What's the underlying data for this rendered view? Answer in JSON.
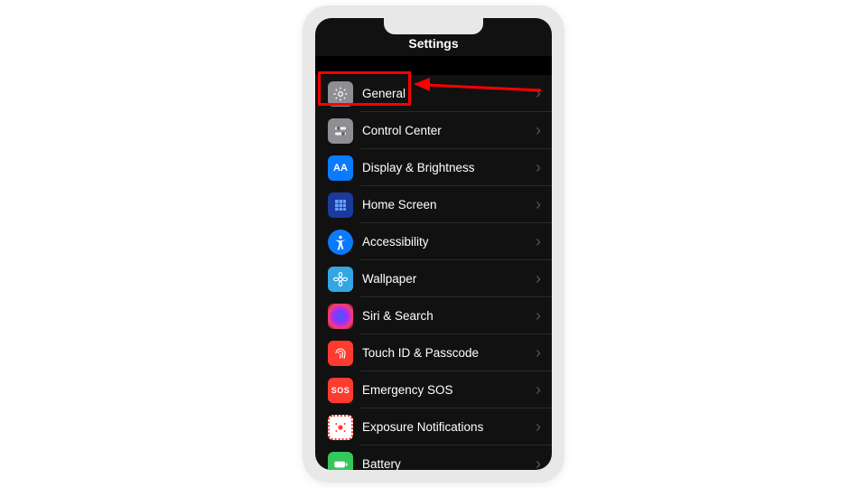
{
  "title": "Settings",
  "rows": [
    {
      "label": "General",
      "icon_name": "gear-icon"
    },
    {
      "label": "Control Center",
      "icon_name": "sliders-icon"
    },
    {
      "label": "Display & Brightness",
      "icon_name": "text-size-icon"
    },
    {
      "label": "Home Screen",
      "icon_name": "grid-icon"
    },
    {
      "label": "Accessibility",
      "icon_name": "person-circle-icon"
    },
    {
      "label": "Wallpaper",
      "icon_name": "flower-icon"
    },
    {
      "label": "Siri & Search",
      "icon_name": "siri-icon"
    },
    {
      "label": "Touch ID & Passcode",
      "icon_name": "fingerprint-icon"
    },
    {
      "label": "Emergency SOS",
      "icon_name": "sos-icon"
    },
    {
      "label": "Exposure Notifications",
      "icon_name": "exposure-icon"
    },
    {
      "label": "Battery",
      "icon_name": "battery-icon"
    }
  ],
  "annotation": {
    "highlight_index": 0,
    "highlight_color": "#ff0000"
  }
}
